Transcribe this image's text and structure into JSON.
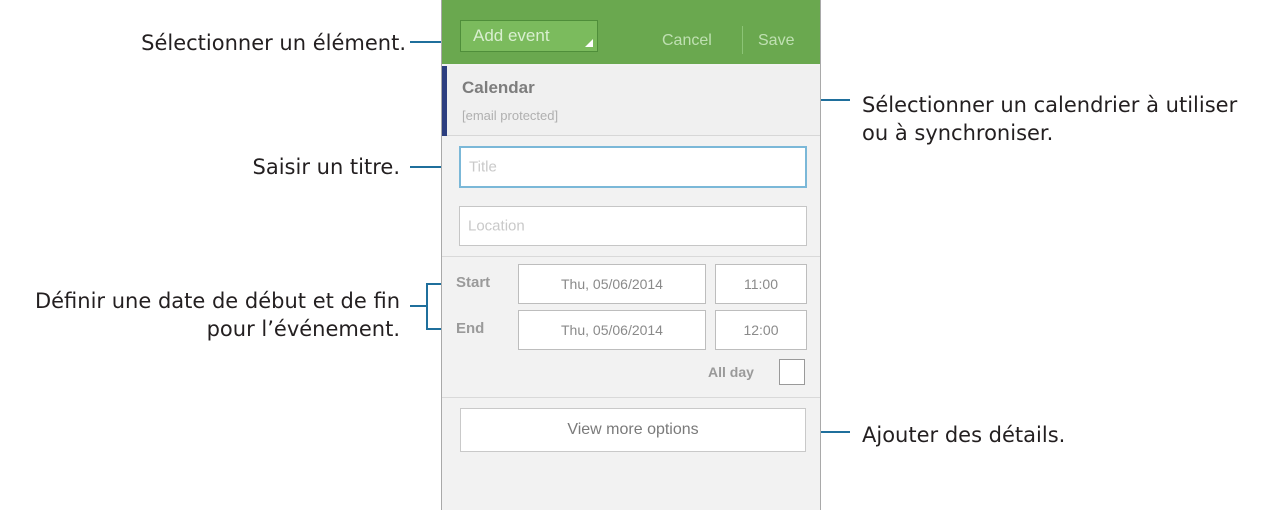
{
  "callouts": {
    "select_item": "Sélectionner un élément.",
    "select_calendar_line1": "Sélectionner un calendrier à utiliser",
    "select_calendar_line2": "ou à synchroniser.",
    "enter_title": "Saisir un titre.",
    "set_dates_line1": "Définir une date de début et de fin",
    "set_dates_line2": "pour l’événement.",
    "add_details": "Ajouter des détails."
  },
  "actionbar": {
    "add_event_label": "Add event",
    "cancel_label": "Cancel",
    "save_label": "Save",
    "color": "#6aa84f"
  },
  "calendar": {
    "title": "Calendar",
    "account": "[email protected]"
  },
  "form": {
    "title_placeholder": "Title",
    "location_placeholder": "Location",
    "start_label": "Start",
    "start_date": "Thu, 05/06/2014",
    "start_time": "11:00",
    "end_label": "End",
    "end_date": "Thu, 05/06/2014",
    "end_time": "12:00",
    "all_day_label": "All day",
    "all_day_checked": false,
    "more_options_label": "View more options"
  },
  "colors": {
    "callout_line": "#1f6f9c",
    "calendar_accent": "#2c3e7f",
    "focus_border": "#7bb8d8"
  }
}
